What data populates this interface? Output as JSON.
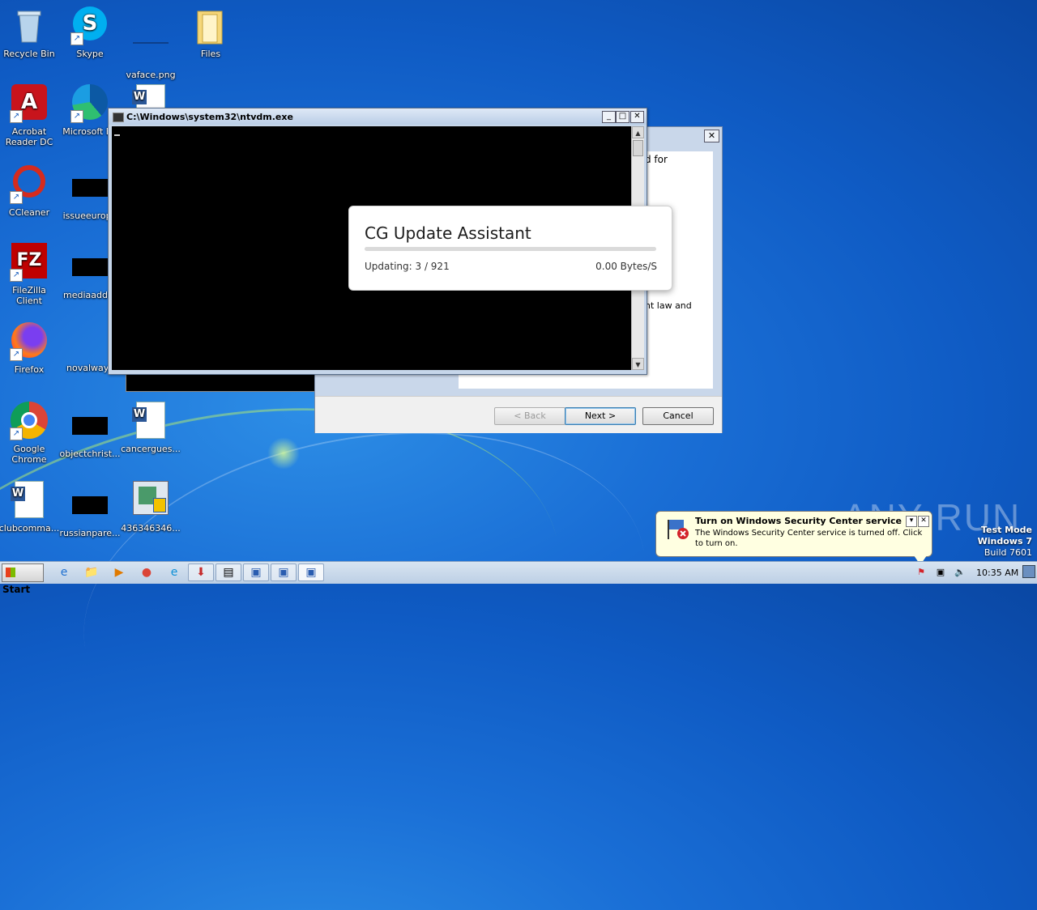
{
  "desktop": {
    "icons": [
      {
        "label": "Recycle Bin",
        "icon": "recycle-bin-icon",
        "glyph": "🗑"
      },
      {
        "label": "Skype",
        "icon": "skype-icon",
        "glyph": "S"
      },
      {
        "label": "vaface.png",
        "icon": "image-file-icon",
        "glyph": ""
      },
      {
        "label": "Files",
        "icon": "folder-icon",
        "glyph": "📁"
      },
      {
        "label": "Acrobat Reader DC",
        "icon": "acrobat-icon",
        "glyph": "A"
      },
      {
        "label": "Microsoft Ed",
        "icon": "edge-icon",
        "glyph": "e"
      },
      {
        "label": "CCleaner",
        "icon": "ccleaner-icon",
        "glyph": "C"
      },
      {
        "label": "issueeurope",
        "icon": "file-icon",
        "glyph": ""
      },
      {
        "label": "FileZilla Client",
        "icon": "filezilla-icon",
        "glyph": "FZ"
      },
      {
        "label": "mediaaddre",
        "icon": "file-icon",
        "glyph": ""
      },
      {
        "label": "Firefox",
        "icon": "firefox-icon",
        "glyph": "🦊"
      },
      {
        "label": "novalways",
        "icon": "file-icon",
        "glyph": ""
      },
      {
        "label": "Google Chrome",
        "icon": "chrome-icon",
        "glyph": "●"
      },
      {
        "label": "objectchrist...",
        "icon": "file-icon",
        "glyph": ""
      },
      {
        "label": "cancergues...",
        "icon": "word-doc-icon",
        "glyph": "W"
      },
      {
        "label": "clubcomma...",
        "icon": "word-doc-icon",
        "glyph": "W"
      },
      {
        "label": "russianpare...",
        "icon": "file-icon",
        "glyph": ""
      },
      {
        "label": "436346346...",
        "icon": "installer-icon",
        "glyph": "▣"
      }
    ]
  },
  "console": {
    "title": "C:\\Windows\\system32\\ntvdm.exe",
    "min": "_",
    "max": "□",
    "close": "✕"
  },
  "wizard": {
    "close": "✕",
    "text_fragment_1": "d for",
    "text_fragment_2": "ht law and",
    "text_fragment_3": "'",
    "back_label": "< Back",
    "next_label": "Next >",
    "cancel_label": "Cancel"
  },
  "update_popup": {
    "title": "CG Update Assistant",
    "status": "Updating: 3 / 921",
    "speed": "0.00 Bytes/S",
    "progress_fraction": 0.0
  },
  "notification": {
    "title": "Turn on Windows Security Center service",
    "text": "The Windows Security Center service is turned off. Click to turn on.",
    "close": "✕",
    "options": "▾"
  },
  "watermark": {
    "text": "ANY RUN"
  },
  "test_mode": {
    "line1": "Test Mode",
    "line2": "Windows 7",
    "line3": "Build 7601"
  },
  "taskbar": {
    "start_label": "Start",
    "pinned": [
      {
        "icon": "ie-icon",
        "glyph": "e"
      },
      {
        "icon": "explorer-icon",
        "glyph": "📁"
      },
      {
        "icon": "media-player-icon",
        "glyph": "▶"
      },
      {
        "icon": "chrome-icon",
        "glyph": "●"
      },
      {
        "icon": "edge-icon",
        "glyph": "e"
      },
      {
        "icon": "installer-icon",
        "glyph": "⬇"
      },
      {
        "icon": "console-icon",
        "glyph": "▤"
      },
      {
        "icon": "setup-icon",
        "glyph": "▣"
      },
      {
        "icon": "setup-icon",
        "glyph": "▣"
      },
      {
        "icon": "setup-icon",
        "glyph": "▣"
      }
    ],
    "clock": "10:35 AM"
  },
  "colors": {
    "popup_progress": "#2f8ad6",
    "desktop_bg": "#1a6fd6"
  }
}
